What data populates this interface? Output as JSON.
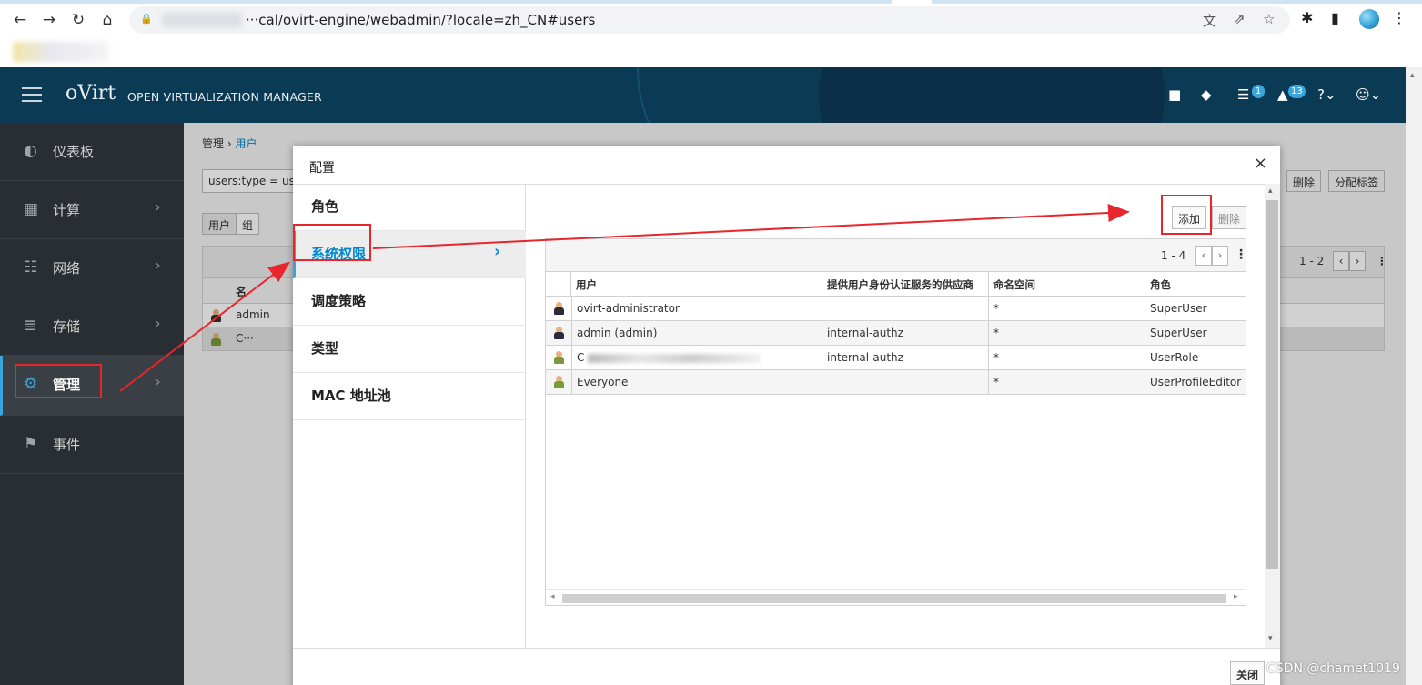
{
  "browser": {
    "url": "···cal/ovirt-engine/webadmin/?locale=zh_CN#users",
    "back_icon": "←",
    "forward_icon": "→",
    "reload_icon": "↻",
    "home_icon": "⌂",
    "lock_icon": "🔒",
    "translate_icon": "文",
    "share_icon": "⇗",
    "star_icon": "☆",
    "extensions_icon": "✱",
    "sidepanel_icon": "▮",
    "menu_icon": "⋮"
  },
  "header": {
    "logo": "oVirt",
    "product": "OPEN VIRTUALIZATION MANAGER",
    "bookmark_icon": "■",
    "tag_icon": "◆",
    "tasks_icon": "☰",
    "tasks_badge": "1",
    "bell_icon": "▲",
    "events_badge": "13",
    "help_icon": "?⌄",
    "user_icon": "☺⌄"
  },
  "sidenav": {
    "items": [
      {
        "label": "仪表板",
        "icon": "◐"
      },
      {
        "label": "计算",
        "icon": "▦",
        "chevron": "›"
      },
      {
        "label": "网络",
        "icon": "☷",
        "chevron": "›"
      },
      {
        "label": "存储",
        "icon": "≣",
        "chevron": "›"
      },
      {
        "label": "管理",
        "icon": "⚙",
        "chevron": "›"
      },
      {
        "label": "事件",
        "icon": "⚑"
      }
    ]
  },
  "page": {
    "breadcrumb_root": "管理",
    "breadcrumb_sep": "›",
    "breadcrumb_current": "用户",
    "search_value": "users:type = use",
    "segment_user": "用户",
    "segment_group": "组",
    "btn_delete": "删除",
    "btn_assign_tags": "分配标签",
    "pager": "1 - 2",
    "pager_prev": "‹",
    "pager_next": "›",
    "pager_menu": "⋮",
    "col_name": "名",
    "rows": [
      "admin",
      "C···"
    ]
  },
  "modal": {
    "title": "配置",
    "close_icon": "×",
    "tabs": [
      {
        "label": "角色"
      },
      {
        "label": "系统权限",
        "chevron": "›"
      },
      {
        "label": "调度策略"
      },
      {
        "label": "类型"
      },
      {
        "label": "MAC 地址池"
      }
    ],
    "add_button": "添加",
    "remove_button": "删除",
    "pager": "1 - 4",
    "pager_prev": "‹",
    "pager_next": "›",
    "pager_menu": "⋮",
    "columns": [
      "用户",
      "提供用户身份认证服务的供应商",
      "命名空间",
      "角色"
    ],
    "rows": [
      {
        "user": "ovirt-administrator",
        "provider": "",
        "namespace": "*",
        "role": "SuperUser"
      },
      {
        "user": "admin (admin)",
        "provider": "internal-authz",
        "namespace": "*",
        "role": "SuperUser"
      },
      {
        "user": "C",
        "provider": "internal-authz",
        "namespace": "*",
        "role": "UserRole"
      },
      {
        "user": "Everyone",
        "provider": "",
        "namespace": "*",
        "role": "UserProfileEditor"
      }
    ],
    "scroll_left": "◂",
    "scroll_right": "▸",
    "scroll_up": "▴",
    "scroll_down": "▾",
    "footer_close": "关闭"
  },
  "watermark": "CSDN @chamet1019",
  "colors": {
    "header_bg": "#0b3a55",
    "nav_bg": "#292e34",
    "accent": "#39a5dc",
    "link": "#0088ce",
    "annotation_red": "#e8262b"
  }
}
